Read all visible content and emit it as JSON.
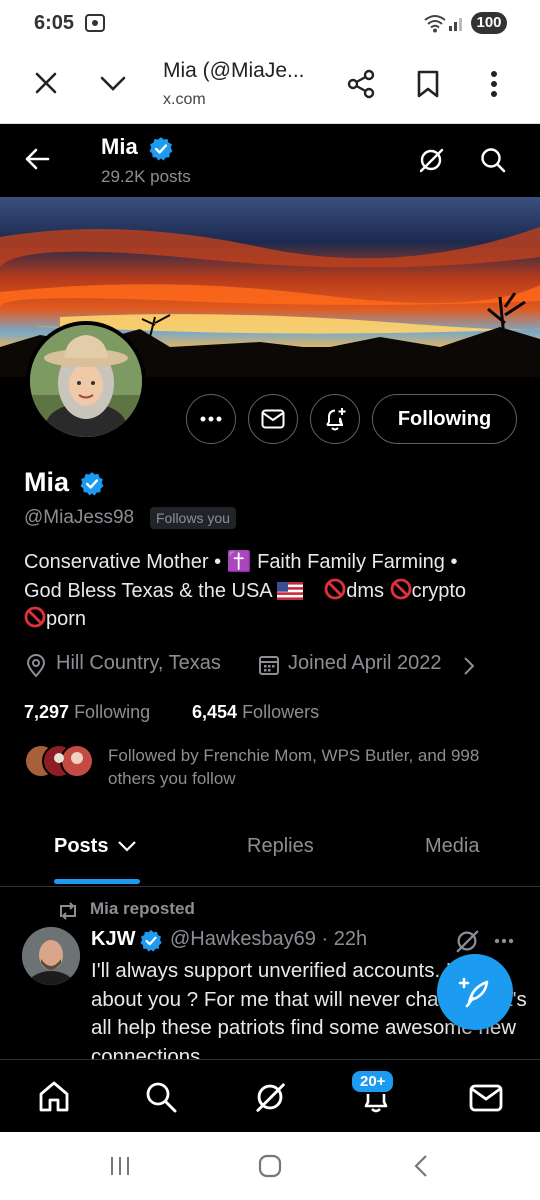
{
  "status_bar": {
    "time": "6:05",
    "battery": "100"
  },
  "browser": {
    "title": "Mia (@MiaJe...",
    "url": "x.com"
  },
  "header": {
    "name": "Mia",
    "post_count": "29.2K posts"
  },
  "profile": {
    "name": "Mia",
    "handle": "@MiaJess98",
    "follows_you": "Follows you",
    "follow_button": "Following",
    "bio_line1": "Conservative Mother • ✝️ Faith Family Farming •",
    "bio_line2_a": "God Bless Texas & the USA",
    "bio_line2_b": "dms",
    "bio_line2_c": "crypto",
    "bio_line3": "porn",
    "location": "Hill Country, Texas",
    "joined": "Joined April 2022",
    "following_count": "7,297",
    "following_label": "Following",
    "followers_count": "6,454",
    "followers_label": "Followers",
    "followed_by": "Followed by Frenchie Mom, WPS Butler, and 998 others you follow"
  },
  "tabs": [
    {
      "label": "Posts"
    },
    {
      "label": "Replies"
    },
    {
      "label": "Media"
    }
  ],
  "tweet": {
    "repost_label": "Mia reposted",
    "author_name": "KJW",
    "author_handle": "@Hawkesbay69 · 22h",
    "text": "I'll always support unverified accounts. How about you ? For me that will never change. Let's all help these patriots find some awesome new connections"
  },
  "bottom_nav": {
    "notifications_badge": "20+"
  },
  "colors": {
    "accent": "#1d9bf0",
    "background": "#000000",
    "secondary_text": "#8b8f94"
  }
}
